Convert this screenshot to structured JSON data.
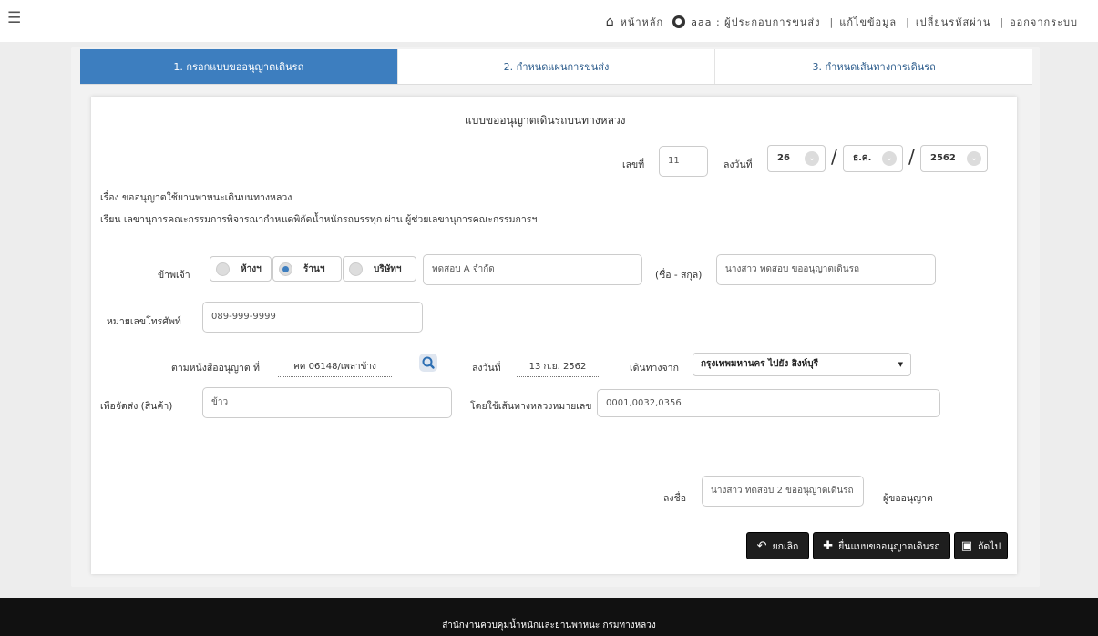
{
  "topnav": {
    "home": "หน้าหลัก",
    "user": "aaa : ผู้ประกอบการขนส่ง",
    "edit": "แก้ไขข้อมูล",
    "change_password": "เปลี่ยนรหัสผ่าน",
    "logout": "ออกจากระบบ"
  },
  "steps": [
    {
      "label": "1. กรอกแบบขออนุญาตเดินรถ"
    },
    {
      "label": "2. กำหนดแผนการขนส่ง"
    },
    {
      "label": "3. กำหนดเส้นทางการเดินรถ"
    }
  ],
  "form": {
    "title": "แบบขออนุญาตเดินรถบนทางหลวง",
    "number_label": "เลขที่",
    "number_value": "11",
    "date_label": "ลงวันที่",
    "day": "26",
    "month": "ธ.ค.",
    "year": "2562",
    "subject": "เรื่อง ขออนุญาตใช้ยานพาหนะเดินบนทางหลวง",
    "to": "เรียน เลขานุการคณะกรรมการพิจารณากำหนดพิกัดน้ำหนักรถบรรทุก ผ่าน ผู้ช่วยเลขานุการคณะกรรมการฯ",
    "applicant_label": "ข้าพเจ้า",
    "type_options": [
      {
        "label": "ห้างฯ",
        "selected": false
      },
      {
        "label": "ร้านฯ",
        "selected": true
      },
      {
        "label": "บริษัทฯ",
        "selected": false
      }
    ],
    "company_value": "ทดสอบ A จำกัด",
    "name_label": "(ชื่อ - สกุล)",
    "name_value": "นางสาว ทดสอบ  ขออนุญาตเดินรถ",
    "phone_label": "หมายเลขโทรศัพท์",
    "phone_value": "089-999-9999",
    "permit_label": "ตามหนังสืออนุญาต ที่",
    "permit_value": "คค 06148/เพลาข้าง",
    "permit_date_label": "ลงวันที่",
    "permit_date_value": "13 ก.ย. 2562",
    "origin_label": "เดินทางจาก",
    "origin_value": "กรุงเทพมหานคร ไปยัง สิงห์บุรี",
    "goods_label": "เพื่อจัดส่ง (สินค้า)",
    "goods_value": "ข้าว",
    "route_label": "โดยใช้เส้นทางหลวงหมายเลข",
    "route_value": "0001,0032,0356",
    "sign_label": "ลงชื่อ",
    "sign_value": "นางสาว ทดสอบ 2 ขออนุญาตเดินรถ",
    "applicant_role": "ผู้ขออนุญาต"
  },
  "buttons": {
    "cancel": "ยกเลิก",
    "submit": "ยื่นแบบขออนุญาตเดินรถ",
    "next": "ถัดไป"
  },
  "footer": {
    "text": "สำนักงานควบคุมน้ำหนักและยานพาหนะ   กรมทางหลวง"
  },
  "colors": {
    "accent": "#3d7ebf",
    "footer": "#111111"
  }
}
